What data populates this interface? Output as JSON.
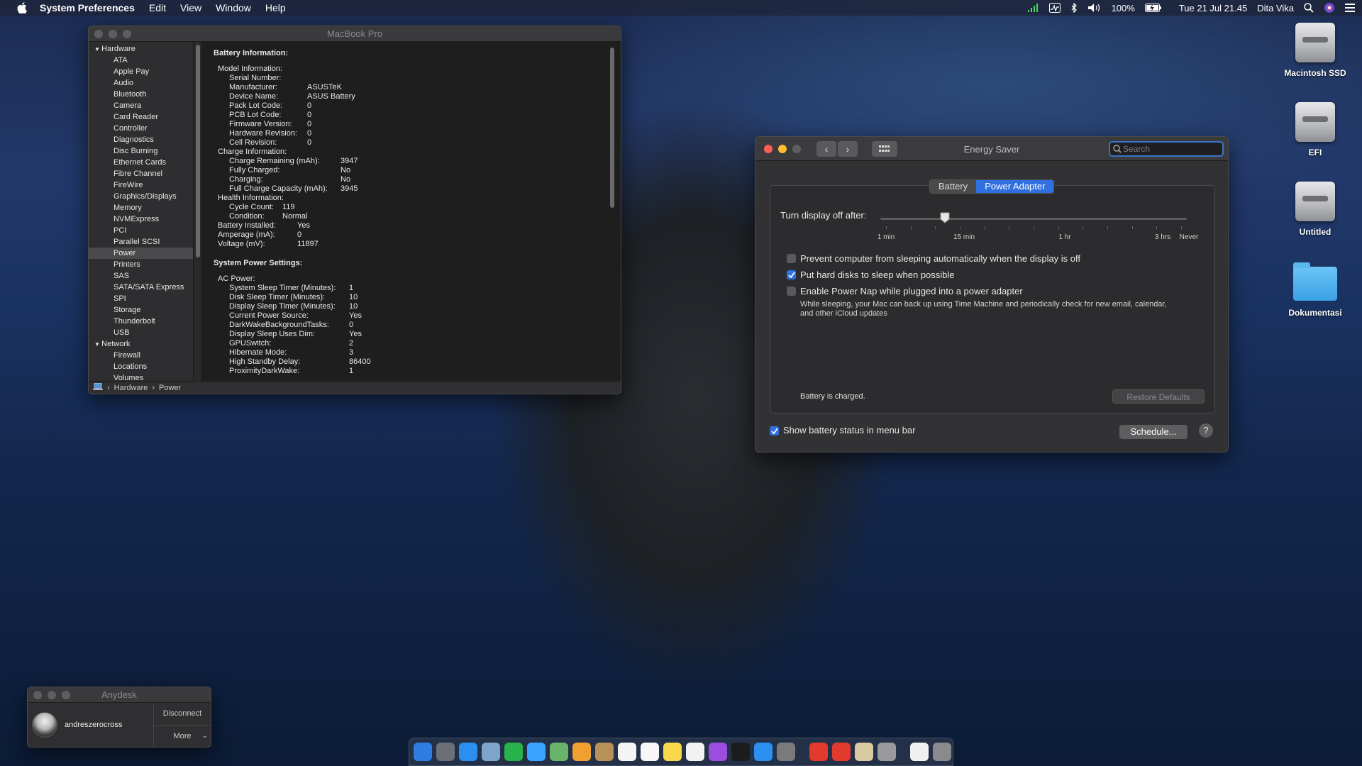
{
  "menubar": {
    "app_name": "System Preferences",
    "menus": [
      "Edit",
      "View",
      "Window",
      "Help"
    ],
    "battery_percent": "100%",
    "datetime": "Tue 21 Jul  21.45",
    "user": "Dita Vika"
  },
  "desktop_icons": [
    {
      "label": "Macintosh SSD",
      "kind": "drive"
    },
    {
      "label": "EFI",
      "kind": "drive"
    },
    {
      "label": "Untitled",
      "kind": "drive"
    },
    {
      "label": "Dokumentasi",
      "kind": "folder"
    }
  ],
  "sysinfo": {
    "title": "MacBook Pro",
    "sidebar": [
      {
        "type": "group",
        "label": "Hardware"
      },
      {
        "type": "item",
        "label": "ATA"
      },
      {
        "type": "item",
        "label": "Apple Pay"
      },
      {
        "type": "item",
        "label": "Audio"
      },
      {
        "type": "item",
        "label": "Bluetooth"
      },
      {
        "type": "item",
        "label": "Camera"
      },
      {
        "type": "item",
        "label": "Card Reader"
      },
      {
        "type": "item",
        "label": "Controller"
      },
      {
        "type": "item",
        "label": "Diagnostics"
      },
      {
        "type": "item",
        "label": "Disc Burning"
      },
      {
        "type": "item",
        "label": "Ethernet Cards"
      },
      {
        "type": "item",
        "label": "Fibre Channel"
      },
      {
        "type": "item",
        "label": "FireWire"
      },
      {
        "type": "item",
        "label": "Graphics/Displays"
      },
      {
        "type": "item",
        "label": "Memory"
      },
      {
        "type": "item",
        "label": "NVMExpress"
      },
      {
        "type": "item",
        "label": "PCI"
      },
      {
        "type": "item",
        "label": "Parallel SCSI"
      },
      {
        "type": "item",
        "label": "Power",
        "selected": true
      },
      {
        "type": "item",
        "label": "Printers"
      },
      {
        "type": "item",
        "label": "SAS"
      },
      {
        "type": "item",
        "label": "SATA/SATA Express"
      },
      {
        "type": "item",
        "label": "SPI"
      },
      {
        "type": "item",
        "label": "Storage"
      },
      {
        "type": "item",
        "label": "Thunderbolt"
      },
      {
        "type": "item",
        "label": "USB"
      },
      {
        "type": "group",
        "label": "Network"
      },
      {
        "type": "item",
        "label": "Firewall"
      },
      {
        "type": "item",
        "label": "Locations"
      },
      {
        "type": "item",
        "label": "Volumes"
      }
    ],
    "battery_header": "Battery Information:",
    "battery_rows": [
      {
        "indent": 1,
        "k": "Model Information:",
        "v": ""
      },
      {
        "indent": 2,
        "k": "Serial Number:",
        "v": ""
      },
      {
        "indent": 2,
        "k": "Manufacturer:",
        "v": "ASUSTeK",
        "w": 110
      },
      {
        "indent": 2,
        "k": "Device Name:",
        "v": "ASUS Battery",
        "w": 110
      },
      {
        "indent": 2,
        "k": "Pack Lot Code:",
        "v": "0",
        "w": 110
      },
      {
        "indent": 2,
        "k": "PCB Lot Code:",
        "v": "0",
        "w": 110
      },
      {
        "indent": 2,
        "k": "Firmware Version:",
        "v": "0",
        "w": 110
      },
      {
        "indent": 2,
        "k": "Hardware Revision:",
        "v": "0",
        "w": 110
      },
      {
        "indent": 2,
        "k": "Cell Revision:",
        "v": "0",
        "w": 110
      },
      {
        "indent": 1,
        "k": "Charge Information:",
        "v": ""
      },
      {
        "indent": 2,
        "k": "Charge Remaining (mAh):",
        "v": "3947",
        "w": 157
      },
      {
        "indent": 2,
        "k": "Fully Charged:",
        "v": "No",
        "w": 157
      },
      {
        "indent": 2,
        "k": "Charging:",
        "v": "No",
        "w": 157
      },
      {
        "indent": 2,
        "k": "Full Charge Capacity (mAh):",
        "v": "3945",
        "w": 157
      },
      {
        "indent": 1,
        "k": "Health Information:",
        "v": ""
      },
      {
        "indent": 2,
        "k": "Cycle Count:",
        "v": "119",
        "w": 75
      },
      {
        "indent": 2,
        "k": "Condition:",
        "v": "Normal",
        "w": 75
      },
      {
        "indent": 1,
        "k": "Battery Installed:",
        "v": "Yes",
        "w": 112
      },
      {
        "indent": 1,
        "k": "Amperage (mA):",
        "v": "0",
        "w": 112
      },
      {
        "indent": 1,
        "k": "Voltage (mV):",
        "v": "11897",
        "w": 112
      }
    ],
    "power_header": "System Power Settings:",
    "power_rows": [
      {
        "indent": 1,
        "k": "AC Power:",
        "v": ""
      },
      {
        "indent": 2,
        "k": "System Sleep Timer (Minutes):",
        "v": "1",
        "w": 169
      },
      {
        "indent": 2,
        "k": "Disk Sleep Timer (Minutes):",
        "v": "10",
        "w": 169
      },
      {
        "indent": 2,
        "k": "Display Sleep Timer (Minutes):",
        "v": "10",
        "w": 169
      },
      {
        "indent": 2,
        "k": "Current Power Source:",
        "v": "Yes",
        "w": 169
      },
      {
        "indent": 2,
        "k": "DarkWakeBackgroundTasks:",
        "v": "0",
        "w": 169
      },
      {
        "indent": 2,
        "k": "Display Sleep Uses Dim:",
        "v": "Yes",
        "w": 169
      },
      {
        "indent": 2,
        "k": "GPUSwitch:",
        "v": "2",
        "w": 169
      },
      {
        "indent": 2,
        "k": "Hibernate Mode:",
        "v": "3",
        "w": 169
      },
      {
        "indent": 2,
        "k": "High Standby Delay:",
        "v": "86400",
        "w": 169
      },
      {
        "indent": 2,
        "k": "ProximityDarkWake:",
        "v": "1",
        "w": 169
      }
    ],
    "pathbar": [
      "Hardware",
      "Power"
    ]
  },
  "energy": {
    "title": "Energy Saver",
    "search_placeholder": "Search",
    "tabs": [
      {
        "label": "Battery",
        "active": false
      },
      {
        "label": "Power Adapter",
        "active": true
      }
    ],
    "slider_label": "Turn display off after:",
    "slider_fraction": 0.21,
    "tick_labels": [
      "1 min",
      "15 min",
      "1 hr",
      "3 hrs",
      "Never"
    ],
    "options": [
      {
        "label": "Prevent computer from sleeping automatically when the display is off",
        "checked": false
      },
      {
        "label": "Put hard disks to sleep when possible",
        "checked": true
      },
      {
        "label": "Enable Power Nap while plugged into a power adapter",
        "checked": false
      }
    ],
    "power_nap_note": "While sleeping, your Mac can back up using Time Machine and periodically check for new email, calendar, and other iCloud updates",
    "status": "Battery is charged.",
    "restore_defaults": "Restore Defaults",
    "show_battery_label": "Show battery status in menu bar",
    "show_battery_checked": true,
    "schedule": "Schedule...",
    "help": "?"
  },
  "anydesk": {
    "title": "Anydesk",
    "user": "andreszerocross",
    "disconnect": "Disconnect",
    "more": "More"
  },
  "dock": {
    "apps": [
      {
        "name": "finder-icon",
        "color": "#2f7de0"
      },
      {
        "name": "launchpad-icon",
        "color": "#6a6f78"
      },
      {
        "name": "safari-icon",
        "color": "#2a8ff0"
      },
      {
        "name": "preview-icon",
        "color": "#7fa4c9"
      },
      {
        "name": "facetime-icon",
        "color": "#27b34a"
      },
      {
        "name": "messages-icon",
        "color": "#3aa3ff"
      },
      {
        "name": "maps-icon",
        "color": "#6ab36a"
      },
      {
        "name": "photos-icon",
        "color": "#f0a030"
      },
      {
        "name": "notes-book-icon",
        "color": "#b8905a"
      },
      {
        "name": "calendar-icon",
        "color": "#f4f4f4"
      },
      {
        "name": "reminders-icon",
        "color": "#f6f6f6"
      },
      {
        "name": "notes-icon",
        "color": "#f7d94a"
      },
      {
        "name": "music-icon",
        "color": "#f2f2f2"
      },
      {
        "name": "podcasts-icon",
        "color": "#9b4de0"
      },
      {
        "name": "tv-icon",
        "color": "#1c1c1c"
      },
      {
        "name": "app-store-icon",
        "color": "#2a8ff0"
      },
      {
        "name": "system-preferences-icon",
        "color": "#7a7a7c"
      },
      {
        "name": "anydesk-icon",
        "color": "#e23b2e"
      },
      {
        "name": "anydesk-alt-icon",
        "color": "#e23b2e"
      },
      {
        "name": "script-icon",
        "color": "#d9c9a0"
      },
      {
        "name": "automator-icon",
        "color": "#9a9a9c"
      },
      {
        "name": "document-icon",
        "color": "#f0f0f0"
      },
      {
        "name": "trash-icon",
        "color": "#8a8a8c"
      }
    ]
  }
}
